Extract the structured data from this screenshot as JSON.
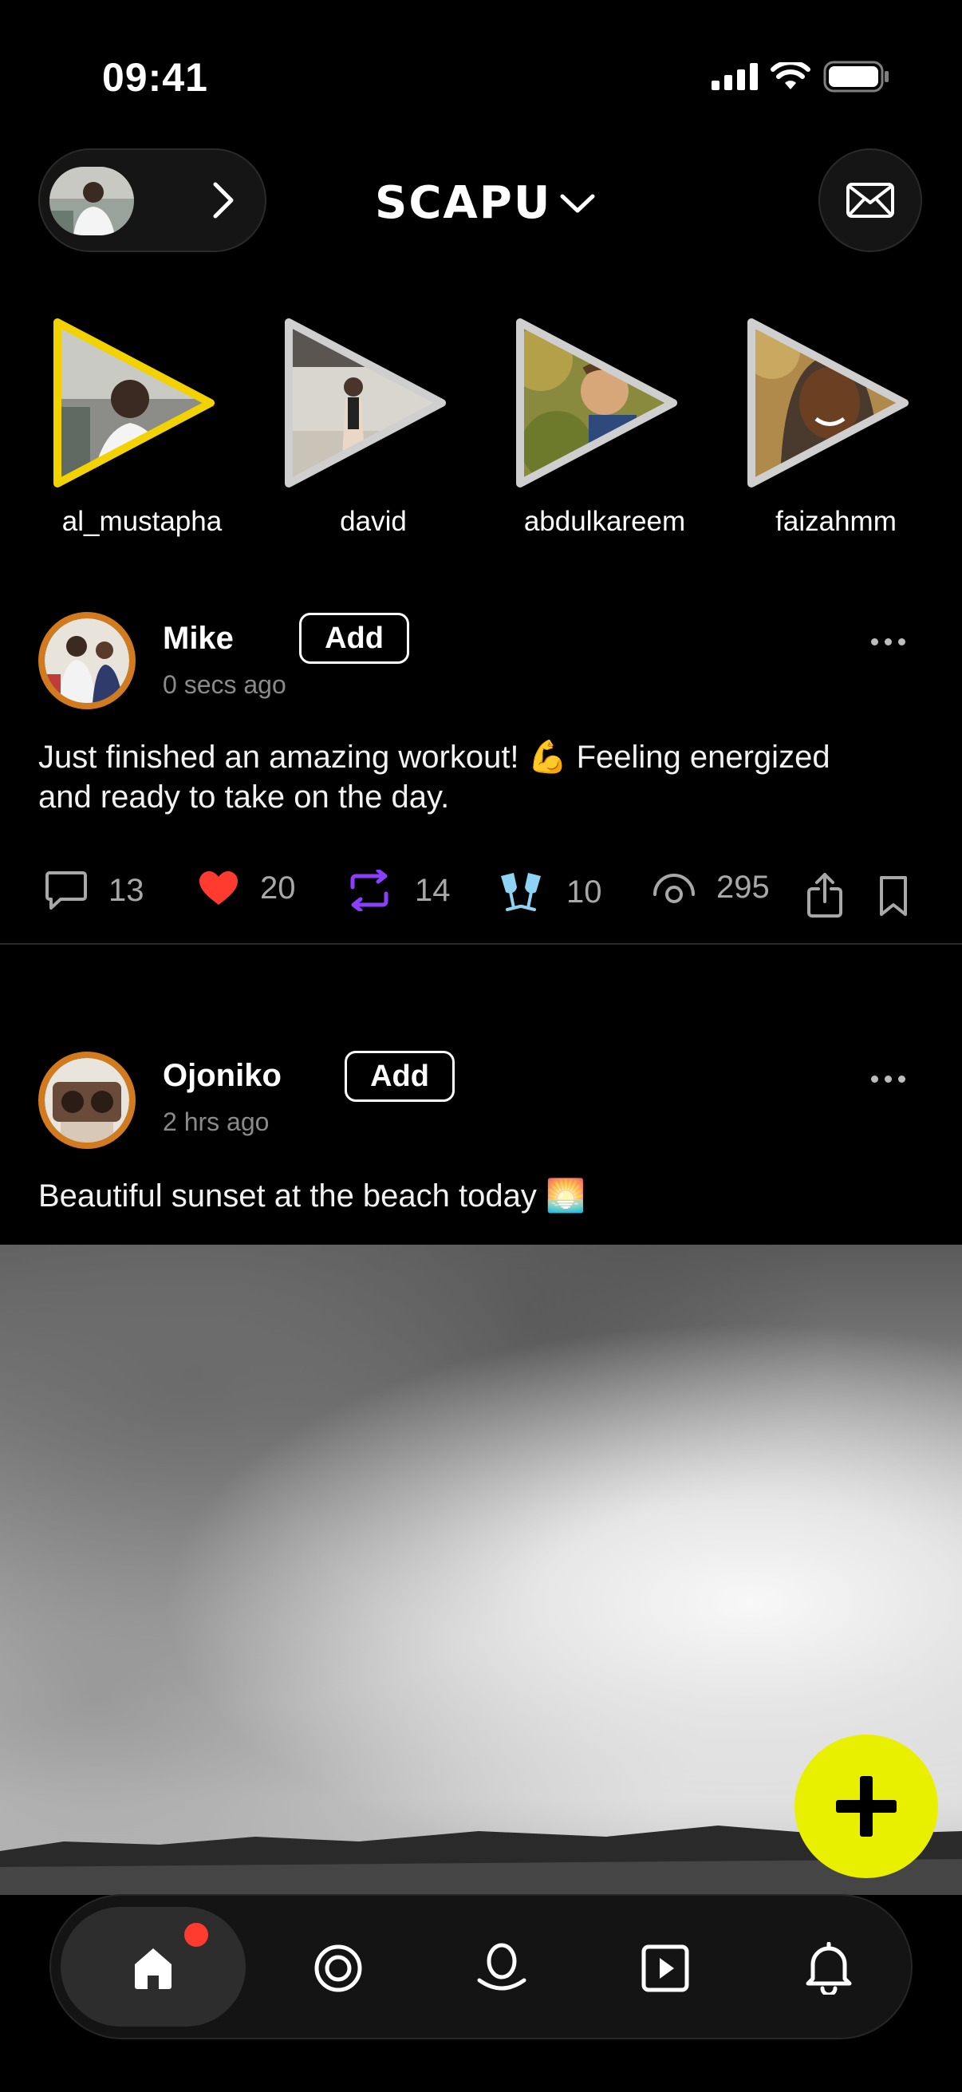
{
  "status_bar": {
    "time": "09:41"
  },
  "header": {
    "brand": "SCAPU"
  },
  "stories": [
    {
      "name": "al_mustapha",
      "active": true
    },
    {
      "name": "david",
      "active": false
    },
    {
      "name": "abdulkareem",
      "active": false
    },
    {
      "name": "faizahmm",
      "active": false
    }
  ],
  "posts": [
    {
      "author": "Mike",
      "time": "0 secs ago",
      "add_label": "Add",
      "text_line1": "Just finished an amazing workout! 💪 Feeling energized",
      "text_line2": "and ready to take on the day.",
      "stats": {
        "comments": "13",
        "likes": "20",
        "reposts": "14",
        "cheers": "10",
        "views": "295"
      }
    },
    {
      "author": "Ojoniko",
      "time": "2 hrs ago",
      "add_label": "Add",
      "text": "Beautiful sunset at the beach today 🌅"
    }
  ],
  "colors": {
    "accent": "#e8f000",
    "story_active": "#f2d200",
    "avatar_ring": "#d27a1e",
    "like": "#ff3b30",
    "repost": "#8a3ffc",
    "cheers": "#8fd3f4"
  },
  "nav": {
    "items": [
      "home-icon",
      "explore-icon",
      "user-icon",
      "video-icon",
      "bell-icon"
    ],
    "active": "home-icon",
    "home_badge": true
  }
}
